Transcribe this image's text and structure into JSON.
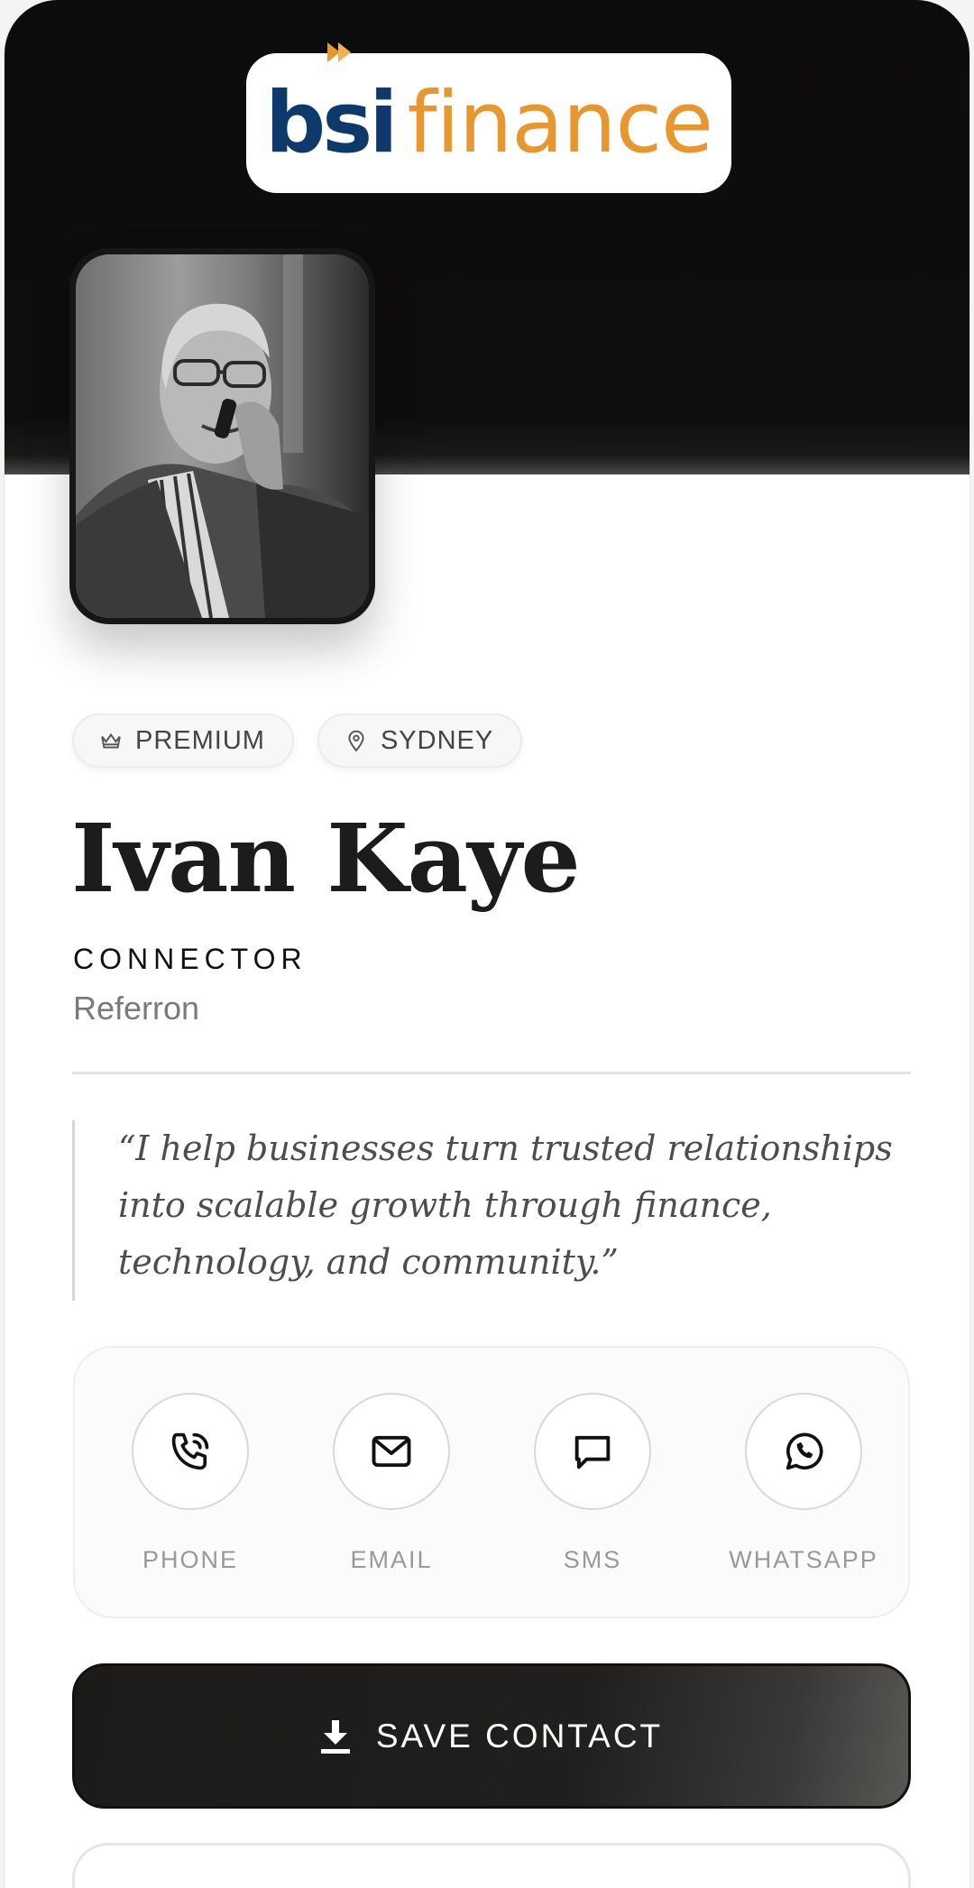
{
  "brand": {
    "logo_part1": "bsi",
    "logo_part2": "finance",
    "colors": {
      "navy": "#0d3a6b",
      "orange": "#e8972f"
    }
  },
  "profile": {
    "photo_alt": "Profile photo",
    "badges": [
      {
        "icon": "crown-icon",
        "label": "PREMIUM"
      },
      {
        "icon": "map-pin-icon",
        "label": "SYDNEY"
      }
    ],
    "name": "Ivan Kaye",
    "role": "CONNECTOR",
    "company": "Referron",
    "quote": "“I help businesses turn trusted relationships into scalable growth through finance, technology, and community.”"
  },
  "actions": [
    {
      "icon": "phone-icon",
      "label": "PHONE"
    },
    {
      "icon": "mail-icon",
      "label": "EMAIL"
    },
    {
      "icon": "message-icon",
      "label": "SMS"
    },
    {
      "icon": "whatsapp-icon",
      "label": "WHATSAPP"
    }
  ],
  "save_button": {
    "icon": "download-icon",
    "label": "SAVE CONTACT"
  },
  "colors": {
    "hero_bg": "#0d0c0c",
    "button_bg": "#1d1b1a",
    "muted_text": "#7a7a7a"
  }
}
